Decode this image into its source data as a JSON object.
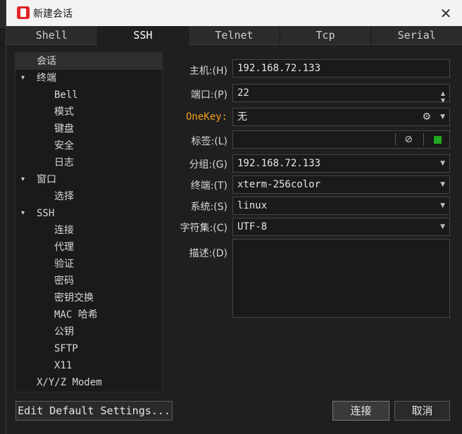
{
  "window": {
    "title": "新建会话",
    "close_glyph": "✕"
  },
  "tabs": [
    {
      "label": "Shell",
      "active": false
    },
    {
      "label": "SSH",
      "active": true
    },
    {
      "label": "Telnet",
      "active": false
    },
    {
      "label": "Tcp",
      "active": false
    },
    {
      "label": "Serial",
      "active": false
    }
  ],
  "tree": [
    {
      "label": "会话",
      "level": 0,
      "selected": true,
      "arrow": ""
    },
    {
      "label": "终端",
      "level": 0,
      "arrow": "▾"
    },
    {
      "label": "Bell",
      "level": 1
    },
    {
      "label": "模式",
      "level": 1
    },
    {
      "label": "键盘",
      "level": 1
    },
    {
      "label": "安全",
      "level": 1
    },
    {
      "label": "日志",
      "level": 1
    },
    {
      "label": "窗口",
      "level": 0,
      "arrow": "▾"
    },
    {
      "label": "选择",
      "level": 1
    },
    {
      "label": "SSH",
      "level": 0,
      "arrow": "▾"
    },
    {
      "label": "连接",
      "level": 1
    },
    {
      "label": "代理",
      "level": 1
    },
    {
      "label": "验证",
      "level": 1
    },
    {
      "label": "密码",
      "level": 1
    },
    {
      "label": "密钥交换",
      "level": 1
    },
    {
      "label": "MAC 哈希",
      "level": 1
    },
    {
      "label": "公钥",
      "level": 1
    },
    {
      "label": "SFTP",
      "level": 1
    },
    {
      "label": "X11",
      "level": 1
    },
    {
      "label": "X/Y/Z Modem",
      "level": 0,
      "arrow": ""
    }
  ],
  "form": {
    "host_label": "主机:(H)",
    "host_value": "192.168.72.133",
    "port_label": "端口:(P)",
    "port_value": "22",
    "onekey_label": "OneKey:",
    "onekey_value": "无",
    "tag_label": "标签:(L)",
    "tag_value": "",
    "group_label": "分组:(G)",
    "group_value": "192.168.72.133",
    "terminal_label": "终端:(T)",
    "terminal_value": "xterm-256color",
    "system_label": "系统:(S)",
    "system_value": "linux",
    "charset_label": "字符集:(C)",
    "charset_value": "UTF-8",
    "desc_label": "描述:(D)",
    "desc_value": ""
  },
  "buttons": {
    "edit_defaults": "Edit Default Settings...",
    "connect": "连接",
    "cancel": "取消"
  },
  "colors": {
    "accent_orange": "#f0a020",
    "tag_green": "#22a822"
  }
}
